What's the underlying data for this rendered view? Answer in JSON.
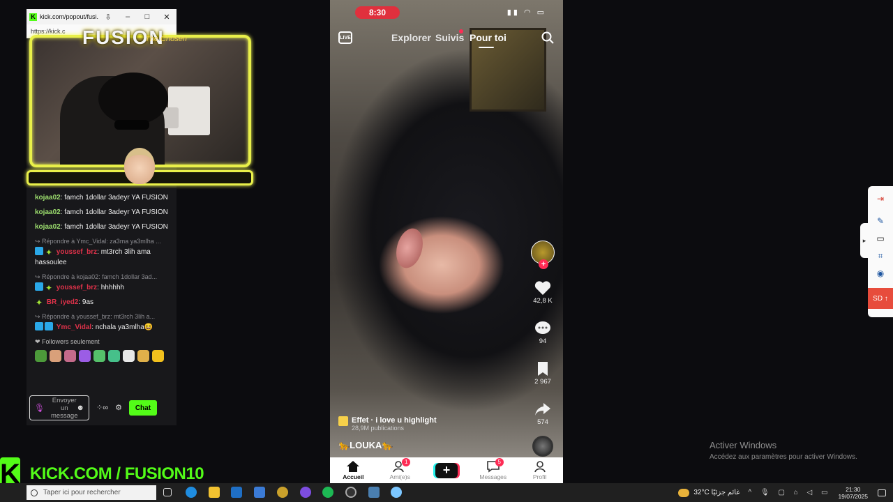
{
  "popout": {
    "title": "kick.com/popout/fusi...",
    "url": "https://kick.c",
    "minimize": "–",
    "maximize": "□",
    "close": "✕",
    "download": "⇩"
  },
  "overlay": {
    "brand": "FUSION",
    "brand_sub": "The Chosen"
  },
  "chat": {
    "messages": [
      {
        "user": "kojaa02",
        "text": ": famch 1dollar 3adeyr YA FUSION"
      },
      {
        "user": "kojaa02",
        "text": ": famch 1dollar 3adeyr YA FUSION"
      },
      {
        "user": "kojaa02",
        "text": ": famch 1dollar 3adeyr YA FUSION"
      },
      {
        "reply": "Répondre à Ymc_Vidal: za3ma ya3mlha ...",
        "user": "youssef_brz",
        "text": ": mt3rch 3lih ama hassoulee"
      },
      {
        "reply": "Répondre à kojaa02: famch 1dollar 3ad...",
        "user": "youssef_brz",
        "text": ": hhhhhh"
      },
      {
        "user": "BR_iyed2",
        "text": ": 9as"
      },
      {
        "reply": "Répondre à youssef_brz: mt3rch 3lih a...",
        "user": "Ymc_Vidal",
        "text": ": nchala ya3mlha😆"
      }
    ],
    "followers_only": "Followers seulement",
    "input_placeholder": "Envoyer un message",
    "chat_button": "Chat"
  },
  "kick_banner": {
    "logo": "K",
    "text": "KICK.COM / FUSION10"
  },
  "tiktok": {
    "time": "8:30",
    "live_label": "LIVE",
    "tabs": [
      "Explorer",
      "Suivis",
      "Pour toi"
    ],
    "actions": {
      "likes": "42,8 K",
      "comments": "94",
      "saves": "2 967",
      "shares": "574"
    },
    "effect_title": "Effet · i love u highlight",
    "effect_sub": "28,9M publications",
    "author": "🐆LOUKA🐆",
    "bottom_nav": [
      {
        "label": "Accueil",
        "badge": ""
      },
      {
        "label": "Ami(e)s",
        "badge": "1"
      },
      {
        "label": "",
        "badge": ""
      },
      {
        "label": "Messages",
        "badge": "5"
      },
      {
        "label": "Profil",
        "badge": ""
      }
    ]
  },
  "sidetool": {
    "sd_label": "SD"
  },
  "activate_windows": {
    "title": "Activer Windows",
    "subtitle": "Accédez aux paramètres pour activer Windows."
  },
  "taskbar": {
    "search_placeholder": "Taper ici pour rechercher",
    "weather": "32°C  غائم جزئيًا",
    "time": "21:30",
    "date": "19/07/2025"
  },
  "colors": {
    "kick_green": "#53fc18",
    "tiktok_red": "#fe2c55",
    "overlay_yellow": "#e9f04a"
  }
}
